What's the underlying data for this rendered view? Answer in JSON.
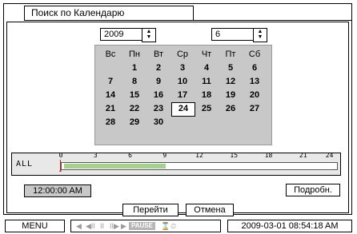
{
  "title": "Поиск по Календарю",
  "year": {
    "value": "2009",
    "up": "▲",
    "down": "▼"
  },
  "month": {
    "value": "6",
    "up": "▲",
    "down": "▼"
  },
  "calendar": {
    "weekdays": [
      "Вс",
      "Пн",
      "Вт",
      "Ср",
      "Чт",
      "Пт",
      "Сб"
    ],
    "weeks": [
      [
        "",
        "1",
        "2",
        "3",
        "4",
        "5",
        "6"
      ],
      [
        "7",
        "8",
        "9",
        "10",
        "11",
        "12",
        "13"
      ],
      [
        "14",
        "15",
        "16",
        "17",
        "18",
        "19",
        "20"
      ],
      [
        "21",
        "22",
        "23",
        "24",
        "25",
        "26",
        "27"
      ],
      [
        "28",
        "29",
        "30",
        "",
        "",
        "",
        ""
      ]
    ],
    "selected_day": "24"
  },
  "timeline": {
    "label": "ALL",
    "ticks": [
      "0",
      "3",
      "6",
      "9",
      "12",
      "15",
      "18",
      "21",
      "24"
    ],
    "recorded_hours": [
      0,
      9
    ],
    "colors": {
      "recorded": "#a5cf8f",
      "cursor": "#d21b1b"
    }
  },
  "time": "12:00:00 AM",
  "buttons": {
    "details": "Подробн.",
    "goto": "Перейти",
    "cancel": "Отмена"
  },
  "status": {
    "menu": "MENU",
    "playback_icons": [
      "◀",
      "◀II",
      "II",
      "II▶",
      "▶"
    ],
    "pause": "PAUSE",
    "extra_icons": [
      "⌛",
      "⏲"
    ],
    "datetime": "2009-03-01  08:54:18 AM"
  }
}
